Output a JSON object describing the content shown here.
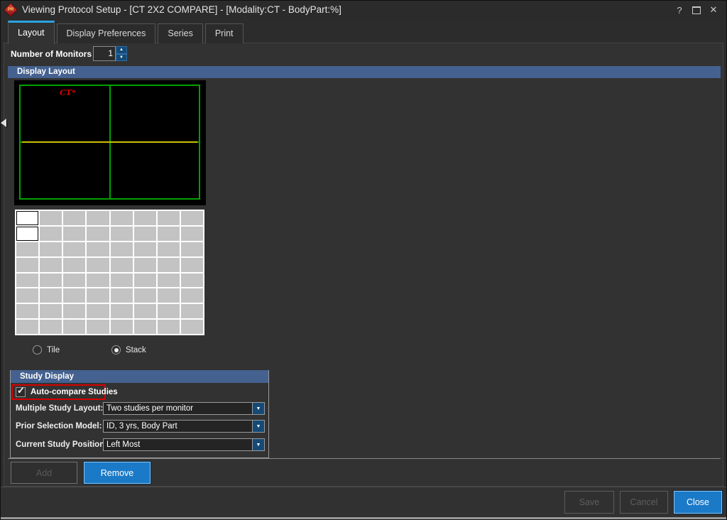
{
  "window": {
    "title": "Viewing Protocol Setup - [CT 2X2 COMPARE] - [Modality:CT - BodyPart:%]",
    "help_glyph": "?",
    "close_glyph": "✕"
  },
  "tabs": [
    {
      "label": "Layout",
      "active": true
    },
    {
      "label": "Display Preferences",
      "active": false
    },
    {
      "label": "Series",
      "active": false
    },
    {
      "label": "Print",
      "active": false
    }
  ],
  "monitors": {
    "label": "Number of Monitors",
    "value": "1"
  },
  "display_layout": {
    "header": "Display Layout",
    "preview": {
      "annotation": "CT*",
      "rows": 2,
      "cols": 2,
      "grid_color": "#00a000",
      "highlight_row_color": "#c9c000",
      "annotation_color": "#d80000"
    },
    "grid_selector": {
      "rows": 8,
      "cols": 8,
      "selected": [
        [
          0,
          0
        ],
        [
          1,
          0
        ]
      ]
    },
    "modes": [
      {
        "label": "Tile",
        "selected": false
      },
      {
        "label": "Stack",
        "selected": true
      }
    ]
  },
  "study_display": {
    "header": "Study Display",
    "auto_compare": {
      "label": "Auto-compare Studies",
      "checked": true,
      "check_glyph": "✓"
    },
    "fields": [
      {
        "label": "Multiple Study Layout:",
        "value": "Two studies per monitor"
      },
      {
        "label": "Prior Selection Model:",
        "value": "ID, 3 yrs, Body Part"
      },
      {
        "label": "Current Study Position:",
        "value": "Left Most"
      }
    ]
  },
  "buttons": {
    "add": "Add",
    "remove": "Remove",
    "save": "Save",
    "cancel": "Cancel",
    "close": "Close"
  },
  "icons": {
    "app_monogram": "PR",
    "dropdown": "▼",
    "spin_up": "▲",
    "spin_down": "▼"
  },
  "colors": {
    "section_header_blue": "#44618f",
    "active_tab_accent": "#2aa4e2",
    "primary_button_blue": "#1b7ac8",
    "annotation_red": "#d80000",
    "grid_green": "#00a000",
    "highlight_yellow": "#c9c000"
  }
}
